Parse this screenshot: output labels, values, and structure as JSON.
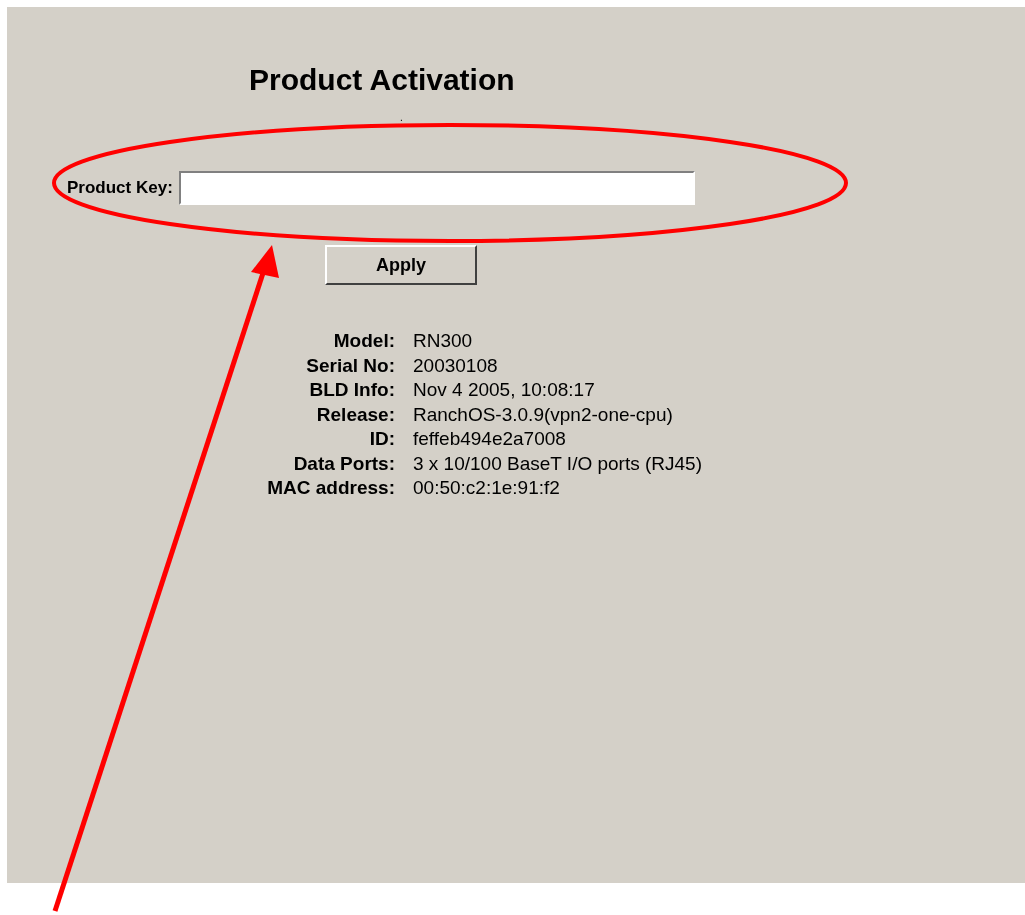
{
  "title": "Product Activation",
  "note": ".",
  "product_key": {
    "label": "Product Key:"
  },
  "apply_button": "Apply",
  "info": [
    {
      "label": "Model:",
      "value": "RN300"
    },
    {
      "label": "Serial No:",
      "value": "20030108"
    },
    {
      "label": "BLD Info:",
      "value": "Nov 4 2005, 10:08:17"
    },
    {
      "label": "Release:",
      "value": "RanchOS-3.0.9(vpn2-one-cpu)"
    },
    {
      "label": "ID:",
      "value": "feffeb494e2a7008"
    },
    {
      "label": "Data Ports:",
      "value": "3 x 10/100 BaseT I/O ports (RJ45)"
    },
    {
      "label": "MAC address:",
      "value": "00:50:c2:1e:91:f2"
    }
  ]
}
